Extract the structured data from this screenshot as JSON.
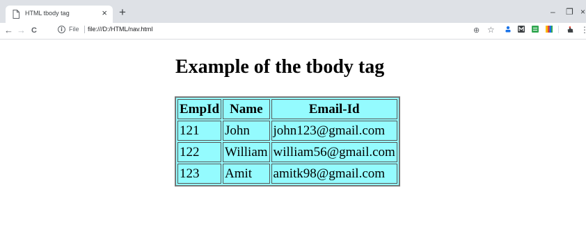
{
  "browser": {
    "tab": {
      "title": "HTML tbody tag",
      "close_glyph": "×",
      "page_icon": "page-icon"
    },
    "new_tab_glyph": "+",
    "window_controls": {
      "minimize": "–",
      "restore": "❐",
      "close": "×"
    },
    "toolbar": {
      "back_glyph": "←",
      "forward_glyph": "→",
      "reload_glyph": "C",
      "info_glyph": "i",
      "scheme_label": "File",
      "url": "file:///D:/HTML/nav.html",
      "zoom_glyph": "⊕",
      "bookmark_glyph": "☆",
      "menu_glyph": "⋮"
    },
    "extensions": [
      "person-extension-icon",
      "m-extension-icon",
      "green-extension-icon",
      "colorbar-extension-icon",
      "hand-extension-icon"
    ],
    "colors": {
      "tabstrip": "#dee1e6",
      "toolbar": "#ffffff"
    }
  },
  "page": {
    "heading": "Example of the tbody tag",
    "table": {
      "headers": [
        "EmpId",
        "Name",
        "Email-Id"
      ],
      "rows": [
        [
          "121",
          "John",
          "john123@gmail.com"
        ],
        [
          "122",
          "William",
          "william56@gmail.com"
        ],
        [
          "123",
          "Amit",
          "amitk98@gmail.com"
        ]
      ],
      "background_color": "#94fbfe"
    }
  }
}
